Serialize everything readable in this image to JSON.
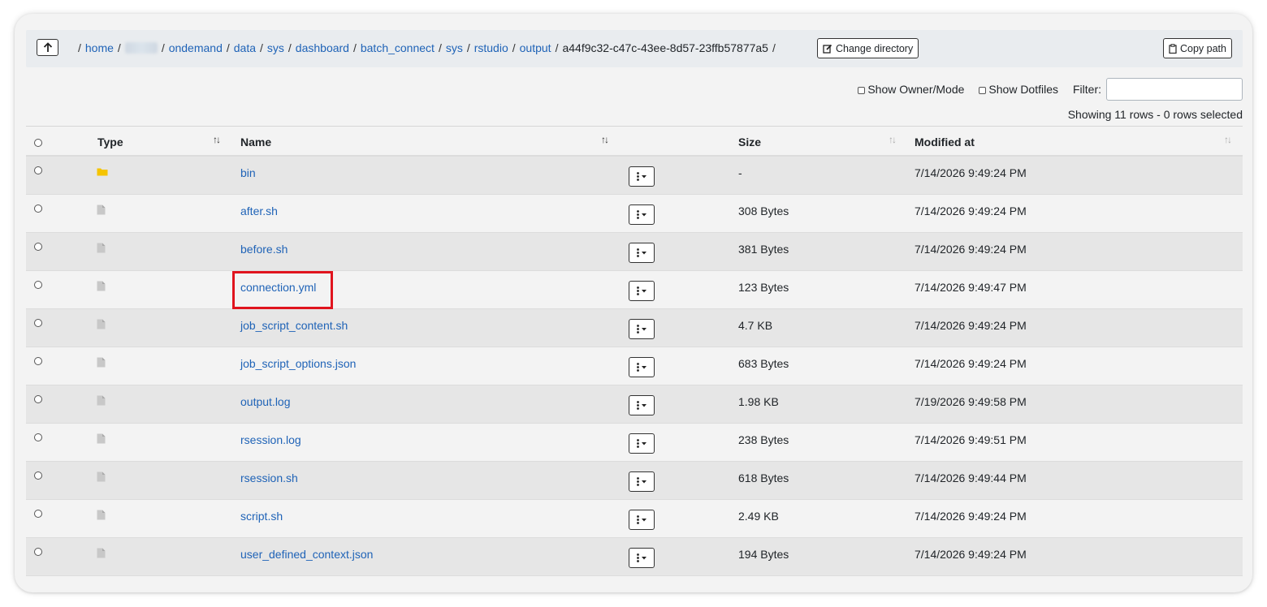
{
  "breadcrumbs": [
    "home",
    "ondemand",
    "data",
    "sys",
    "dashboard",
    "batch_connect",
    "sys",
    "rstudio",
    "output"
  ],
  "current_dir": "a44f9c32-c47c-43ee-8d57-23ffb57877a5",
  "buttons": {
    "change_directory": "Change directory",
    "copy_path": "Copy path"
  },
  "options": {
    "show_owner_mode": "Show Owner/Mode",
    "show_dotfiles": "Show Dotfiles",
    "filter_label": "Filter:",
    "filter_value": ""
  },
  "status": "Showing 11 rows - 0 rows selected",
  "columns": {
    "type": "Type",
    "name": "Name",
    "size": "Size",
    "modified": "Modified at"
  },
  "rows": [
    {
      "type": "folder",
      "name": "bin",
      "size": "-",
      "modified": "7/14/2026 9:49:24 PM"
    },
    {
      "type": "file",
      "name": "after.sh",
      "size": "308 Bytes",
      "modified": "7/14/2026 9:49:24 PM"
    },
    {
      "type": "file",
      "name": "before.sh",
      "size": "381 Bytes",
      "modified": "7/14/2026 9:49:24 PM"
    },
    {
      "type": "file",
      "name": "connection.yml",
      "size": "123 Bytes",
      "modified": "7/14/2026 9:49:47 PM",
      "highlighted": true
    },
    {
      "type": "file",
      "name": "job_script_content.sh",
      "size": "4.7 KB",
      "modified": "7/14/2026 9:49:24 PM"
    },
    {
      "type": "file",
      "name": "job_script_options.json",
      "size": "683 Bytes",
      "modified": "7/14/2026 9:49:24 PM"
    },
    {
      "type": "file",
      "name": "output.log",
      "size": "1.98 KB",
      "modified": "7/19/2026 9:49:58 PM"
    },
    {
      "type": "file",
      "name": "rsession.log",
      "size": "238 Bytes",
      "modified": "7/14/2026 9:49:51 PM"
    },
    {
      "type": "file",
      "name": "rsession.sh",
      "size": "618 Bytes",
      "modified": "7/14/2026 9:49:44 PM"
    },
    {
      "type": "file",
      "name": "script.sh",
      "size": "2.49 KB",
      "modified": "7/14/2026 9:49:24 PM"
    },
    {
      "type": "file",
      "name": "user_defined_context.json",
      "size": "194 Bytes",
      "modified": "7/14/2026 9:49:24 PM"
    }
  ],
  "colors": {
    "link": "#1f63b7",
    "folder": "#f5c400",
    "file_icon": "#c8c8c8",
    "highlight": "#e0141e",
    "row_odd": "#e6e6e6",
    "row_even": "#f3f3f3"
  }
}
